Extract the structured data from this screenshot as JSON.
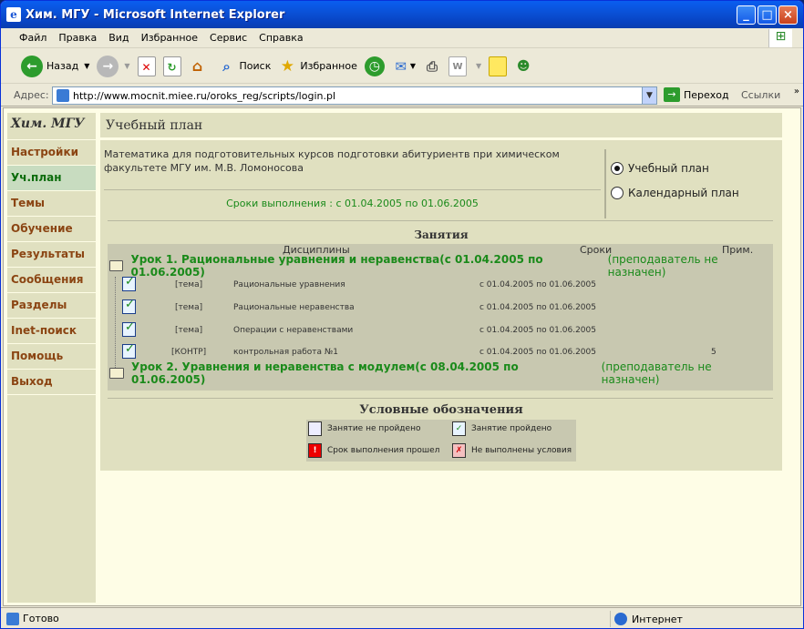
{
  "window": {
    "title": "Хим. МГУ - Microsoft Internet Explorer"
  },
  "menu": [
    "Файл",
    "Правка",
    "Вид",
    "Избранное",
    "Сервис",
    "Справка"
  ],
  "toolbar": {
    "back": "Назад",
    "search": "Поиск",
    "favorites": "Избранное"
  },
  "address": {
    "label": "Адрес:",
    "url": "http://www.mocnit.miee.ru/oroks_reg/scripts/login.pl",
    "go": "Переход",
    "links": "Ссылки"
  },
  "sidebar": {
    "logo": "Хим. МГУ",
    "items": [
      "Настройки",
      "Уч.план",
      "Темы",
      "Обучение",
      "Результаты",
      "Сообщения",
      "Разделы",
      "Inet-поиск",
      "Помощь",
      "Выход"
    ]
  },
  "page": {
    "title": "Учебный план",
    "description": "Математика для подготовительных курсов подготовки абитуриентв при химическом факультете МГУ им. М.В. Ломоносова",
    "dates": "Сроки выполнения : с 01.04.2005 по 01.06.2005",
    "radio1": "Учебный план",
    "radio2": "Календарный план",
    "classes_title": "Занятия",
    "col_disc": "Дисциплины",
    "col_dates": "Сроки",
    "col_note": "Прим.",
    "lesson1": "Урок 1. Рациональные уравнения и неравенства(с 01.04.2005 по 01.06.2005)",
    "lesson1_teacher": "(преподаватель не назначен)",
    "lesson2": "Урок 2. Уравнения и неравенства с модулем(с 08.04.2005 по 01.06.2005)",
    "lesson2_teacher": "(преподаватель не назначен)",
    "rows": [
      {
        "type": "[тема]",
        "name": "Рациональные уравнения",
        "dates": "с 01.04.2005 по 01.06.2005",
        "note": ""
      },
      {
        "type": "[тема]",
        "name": "Рациональные неравенства",
        "dates": "с 01.04.2005 по 01.06.2005",
        "note": ""
      },
      {
        "type": "[тема]",
        "name": "Операции с неравенствами",
        "dates": "с 01.04.2005 по 01.06.2005",
        "note": ""
      },
      {
        "type": "[КОНТР]",
        "name": "контрольная работа №1",
        "dates": "с 01.04.2005 по 01.06.2005",
        "note": "5"
      }
    ],
    "legend_title": "Условные обозначения",
    "legend": [
      "Занятие не пройдено",
      "Занятие пройдено",
      "Срок выполнения прошел",
      "Не выполнены условия"
    ]
  },
  "status": {
    "text": "Готово",
    "zone": "Интернет"
  },
  "colors": {
    "green": "#1a8a1a",
    "brown": "#8b4513",
    "panel": "#e0e0c0",
    "bg": "#fefde6"
  }
}
